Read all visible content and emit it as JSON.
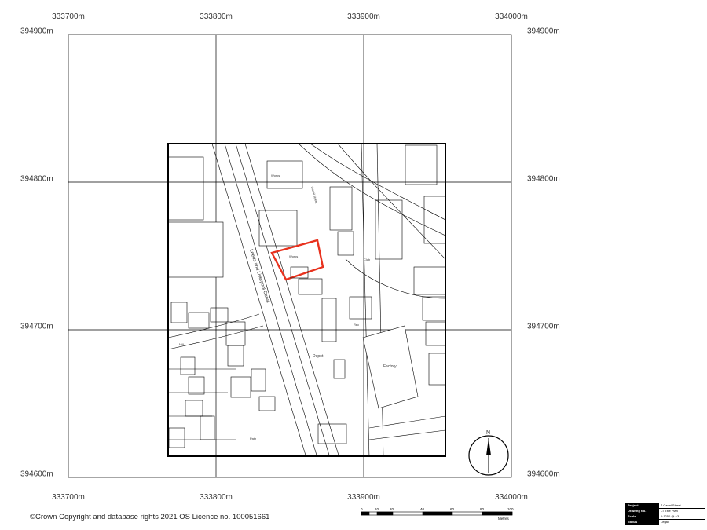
{
  "grid": {
    "eastings_top": [
      "333700m",
      "333800m",
      "333900m",
      "334000m"
    ],
    "eastings_bottom": [
      "333700m",
      "333800m",
      "333900m",
      "334000m"
    ],
    "northings_left": [
      "394900m",
      "394800m",
      "394700m",
      "394600m"
    ],
    "northings_right": [
      "394900m",
      "394800m",
      "394700m",
      "394600m"
    ]
  },
  "map_labels": {
    "canal": "Leeds and Liverpool Canal",
    "depot": "Depot",
    "factory": "Factory",
    "works_1": "Works",
    "works_2": "Works",
    "canal_st": "Canal Street",
    "path": "Path",
    "small_1": "Rec",
    "small_2": "Club",
    "small_3": "Mill"
  },
  "north_arrow": {
    "label": "N"
  },
  "copyright": "©Crown Copyright and database rights 2021 OS Licence no. 100051661",
  "scale": {
    "ticks": [
      "0",
      "10",
      "20",
      "40",
      "60",
      "80",
      "100"
    ],
    "unit": "Metres"
  },
  "title_block": {
    "rows": [
      {
        "key": "Project",
        "value": "7 Canal Street"
      },
      {
        "key": "Drawing No.",
        "value": "LT Title Plan"
      },
      {
        "key": "Scale",
        "value": "1:1250 @ A3"
      },
      {
        "key": "Status",
        "value": "Legal"
      }
    ]
  },
  "colors": {
    "site_boundary": "#e8321e",
    "linework": "#000000"
  }
}
